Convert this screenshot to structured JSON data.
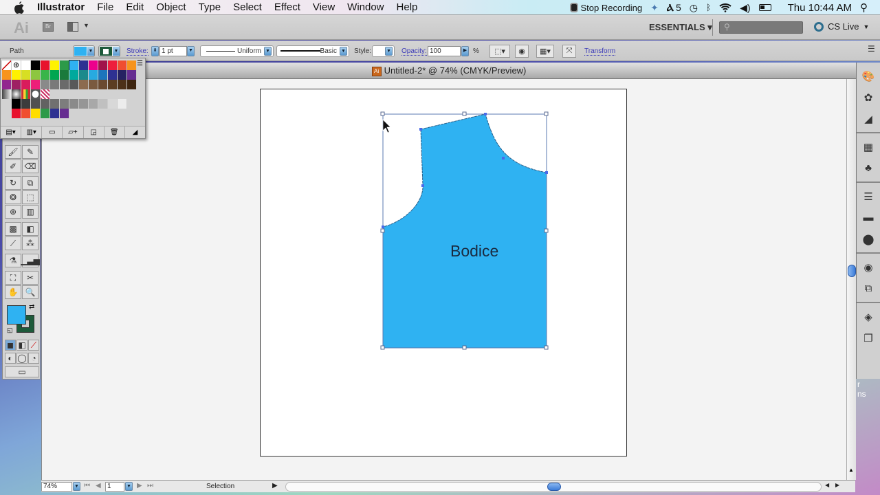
{
  "menubar": {
    "app_name": "Illustrator",
    "menus": [
      "File",
      "Edit",
      "Object",
      "Type",
      "Select",
      "Effect",
      "View",
      "Window",
      "Help"
    ],
    "stop_recording": "Stop Recording",
    "adobe_updates": "5",
    "clock": "Thu 10:44 AM"
  },
  "appbar": {
    "logo": "Ai",
    "bridge": "Br",
    "workspace": "ESSENTIALS ▾",
    "search_placeholder": "",
    "cs_live": "CS Live"
  },
  "control": {
    "selection_type": "Path",
    "fill_color": "#2fb2f2",
    "stroke_color": "#1d5a3a",
    "stroke_label": "Stroke:",
    "stroke_weight": "1 pt",
    "profile": "Uniform",
    "brush": "Basic",
    "style_label": "Style:",
    "opacity_label": "Opacity:",
    "opacity_value": "100",
    "percent": "%",
    "transform_link": "Transform"
  },
  "swatches": {
    "rows": [
      [
        "none",
        "registration",
        "#ffffff",
        "#000000",
        "#e8112d",
        "#fff200",
        "#2c9a48",
        "#2fb2f2",
        "#2e3192",
        "#ec008c",
        "#a0124a",
        "#ee1d3c",
        "#f04e30",
        "#f7941d"
      ],
      [
        "#f7941d",
        "#fff200",
        "#d7df23",
        "#8dc63f",
        "#39b54a",
        "#00a651",
        "#1a7a3c",
        "#00a99d",
        "#1b8a8c",
        "#27aae1",
        "#1c75bc",
        "#2e3192",
        "#262262",
        "#662d91"
      ],
      [
        "#92278f",
        "#9e1f63",
        "#d91c5c",
        "#ed1e79",
        "#8a8a8a",
        "#7a7a7a",
        "#6a6a6a",
        "#595959",
        "#8c6b4f",
        "#7a5a3f",
        "#6b4a30",
        "#5c3d22",
        "#4d3119",
        "#3e2510"
      ]
    ],
    "pattern_row": [
      "gradient-fade",
      "radial-gradient",
      "stripes",
      "radial-white",
      "pattern"
    ],
    "gray_row": [
      "#000000",
      "#3c3c3c",
      "#505050",
      "#626262",
      "#707070",
      "#7d7d7d",
      "#8a8a8a",
      "#969696",
      "#a8a8a8",
      "#c0c0c0",
      "#d8d8d8",
      "#ececec"
    ],
    "bright_row": [
      "#e8112d",
      "#f04e30",
      "#ffdd00",
      "#2c9a48",
      "#2e3192",
      "#662d91"
    ]
  },
  "document": {
    "title": "Untitled-2* @ 74% (CMYK/Preview)",
    "shape_label": "Bodice",
    "shape_color": "#2fb2f2"
  },
  "statusbar": {
    "zoom": "74%",
    "page": "1",
    "tool": "Selection"
  },
  "desktop_text": [
    "r",
    "ns"
  ]
}
